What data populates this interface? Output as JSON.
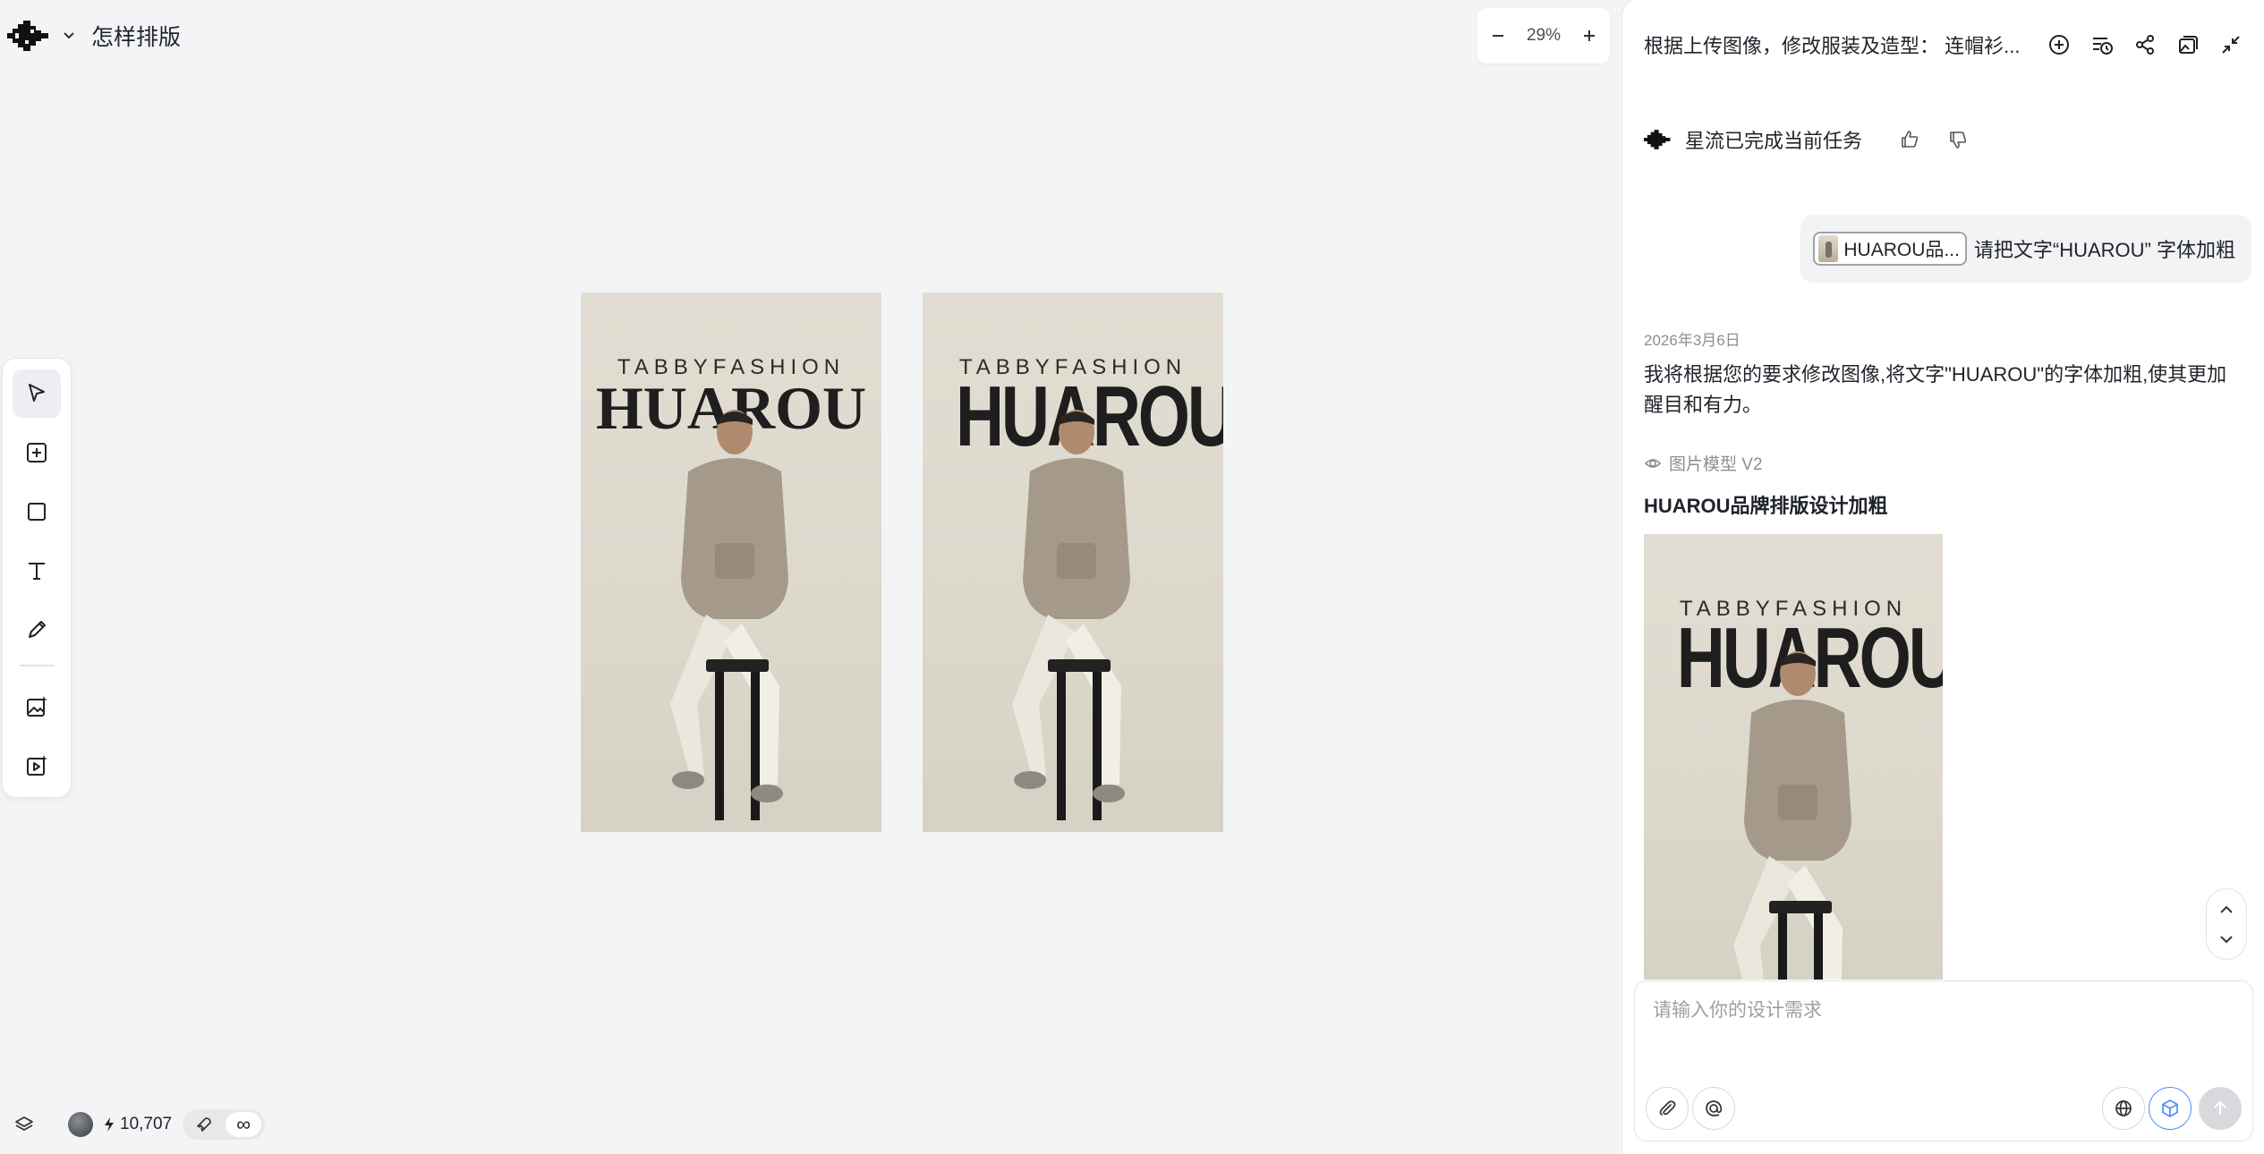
{
  "app": {
    "project_title": "怎样排版",
    "zoom": "29%"
  },
  "toolbar": {
    "tools": [
      "select",
      "add-frame",
      "rectangle",
      "text",
      "pen",
      "image-generate",
      "video-generate"
    ]
  },
  "footer": {
    "credits": "10,707",
    "mode_infinite": "∞"
  },
  "posters": [
    {
      "subtitle": "TABBYFASHION",
      "brand": "HUAROU",
      "style": "serif"
    },
    {
      "subtitle": "TABBYFASHION",
      "brand": "HUAROU",
      "style": "bold"
    }
  ],
  "panel": {
    "title": "根据上传图像，修改服装及造型：  连帽衫...",
    "status": "星流已完成当前任务",
    "user_message": {
      "chip_label": "HUAROU品...",
      "text": "请把文字“HUAROU” 字体加粗"
    },
    "date": "2026年3月6日",
    "ai_reply": "我将根据您的要求修改图像,将文字\"HUAROU\"的字体加粗,使其更加醒目和有力。",
    "model": "图片模型 V2",
    "result_title": "HUAROU品牌排版设计加粗",
    "result_image": {
      "subtitle": "TABBYFASHION",
      "brand": "HUAROU"
    },
    "input_placeholder": "请输入你的设计需求"
  },
  "colors": {
    "canvas_bg": "#f3f4f6",
    "panel_bg": "#ffffff",
    "accent": "#4f8ef7",
    "poster_bg": "#e0dbcf"
  }
}
